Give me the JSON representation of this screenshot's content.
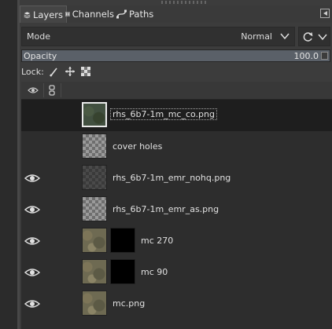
{
  "tabs": [
    {
      "label": "Layers",
      "icon": "layers-icon",
      "active": true
    },
    {
      "label": "Channels",
      "icon": "channels-icon",
      "active": false
    },
    {
      "label": "Paths",
      "icon": "paths-icon",
      "active": false
    }
  ],
  "mode": {
    "label": "Mode",
    "value": "Normal"
  },
  "opacity": {
    "label": "Opacity",
    "value": "100.0",
    "fraction": 1.0
  },
  "lock": {
    "label": "Lock:"
  },
  "layers": [
    {
      "name": "rhs_6b7-1m_mc_co.png",
      "visible": false,
      "selected": true,
      "thumb": "camo-green",
      "mask": false
    },
    {
      "name": "cover holes",
      "visible": false,
      "selected": false,
      "thumb": "transparent",
      "mask": false
    },
    {
      "name": "rhs_6b7-1m_emr_nohq.png",
      "visible": true,
      "selected": false,
      "thumb": "transparent-dark",
      "mask": false
    },
    {
      "name": "rhs_6b7-1m_emr_as.png",
      "visible": true,
      "selected": false,
      "thumb": "transparent",
      "mask": false
    },
    {
      "name": "mc 270",
      "visible": true,
      "selected": false,
      "thumb": "camo",
      "mask": true
    },
    {
      "name": "mc 90",
      "visible": true,
      "selected": false,
      "thumb": "camo",
      "mask": true
    },
    {
      "name": "mc.png",
      "visible": true,
      "selected": false,
      "thumb": "camo",
      "mask": false
    }
  ]
}
